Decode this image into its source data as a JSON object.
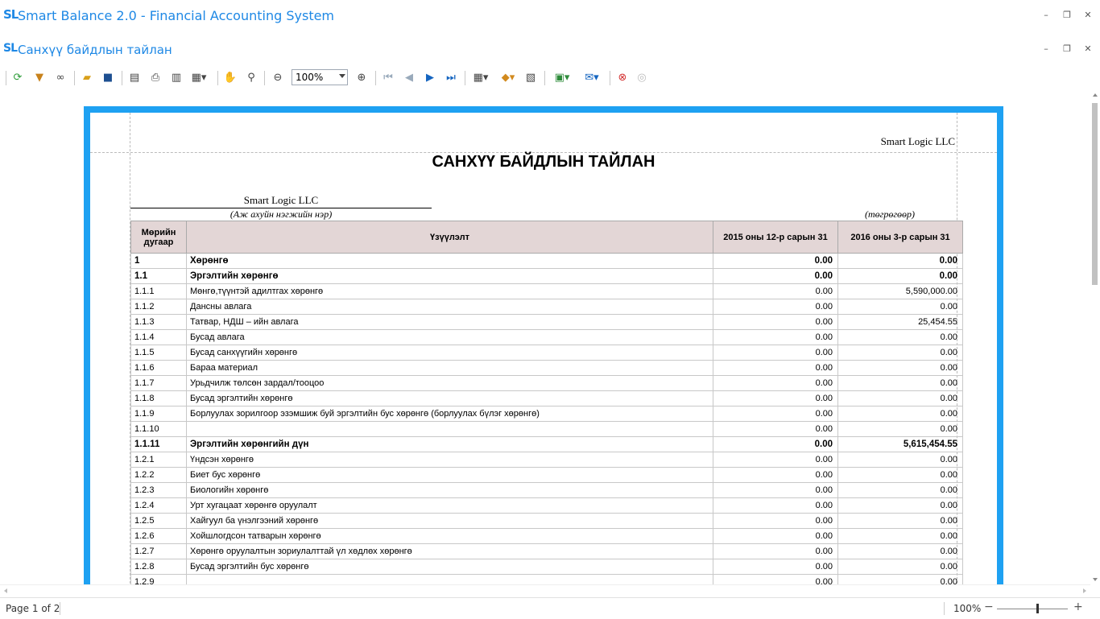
{
  "app": {
    "logo": "SL",
    "title": "Smart Balance 2.0 - Financial Accounting System",
    "window_title": "Санхүү байдлын тайлан"
  },
  "toolbar": {
    "zoom": "100%"
  },
  "report": {
    "company_top": "Smart Logic LLC",
    "title": "САНХҮҮ БАЙДЛЫН ТАЙЛАН",
    "company_name": "Smart Logic LLC",
    "company_caption": "(Аж ахуйн нэгжийн нэр)",
    "currency_caption": "(төгрөгөөр)",
    "columns": [
      "Мөрийн дугаар",
      "Үзүүлэлт",
      "2015 оны 12-р сарын 31",
      "2016 оны 3-р сарын 31"
    ],
    "rows": [
      {
        "code": "1",
        "name": "Хөрөнгө",
        "v1": "0.00",
        "v2": "0.00",
        "bold": true
      },
      {
        "code": "1.1",
        "name": "Эргэлтийн хөрөнгө",
        "v1": "0.00",
        "v2": "0.00",
        "bold": true
      },
      {
        "code": "1.1.1",
        "name": "Мөнгө,түүнтэй адилтгах хөрөнгө",
        "v1": "0.00",
        "v2": "5,590,000.00",
        "bold": false
      },
      {
        "code": "1.1.2",
        "name": "Дансны авлага",
        "v1": "0.00",
        "v2": "0.00",
        "bold": false
      },
      {
        "code": "1.1.3",
        "name": "Татвар, НДШ – ийн авлага",
        "v1": "0.00",
        "v2": "25,454.55",
        "bold": false
      },
      {
        "code": "1.1.4",
        "name": "Бусад авлага",
        "v1": "0.00",
        "v2": "0.00",
        "bold": false
      },
      {
        "code": "1.1.5",
        "name": "Бусад санхүүгийн хөрөнгө",
        "v1": "0.00",
        "v2": "0.00",
        "bold": false
      },
      {
        "code": "1.1.6",
        "name": "Бараа материал",
        "v1": "0.00",
        "v2": "0.00",
        "bold": false
      },
      {
        "code": "1.1.7",
        "name": "Урьдчилж төлсөн зардал/тооцоо",
        "v1": "0.00",
        "v2": "0.00",
        "bold": false
      },
      {
        "code": "1.1.8",
        "name": "Бусад эргэлтийн хөрөнгө",
        "v1": "0.00",
        "v2": "0.00",
        "bold": false
      },
      {
        "code": "1.1.9",
        "name": "Борлуулах зорилгоор эзэмшиж буй эргэлтийн бус хөрөнгө (борлуулах бүлэг хөрөнгө)",
        "v1": "0.00",
        "v2": "0.00",
        "bold": false
      },
      {
        "code": "1.1.10",
        "name": "",
        "v1": "0.00",
        "v2": "0.00",
        "bold": false
      },
      {
        "code": "1.1.11",
        "name": "Эргэлтийн хөрөнгийн дүн",
        "v1": "0.00",
        "v2": "5,615,454.55",
        "bold": true
      },
      {
        "code": "1.2.1",
        "name": "Үндсэн хөрөнгө",
        "v1": "0.00",
        "v2": "0.00",
        "bold": false
      },
      {
        "code": "1.2.2",
        "name": "Биет бус хөрөнгө",
        "v1": "0.00",
        "v2": "0.00",
        "bold": false
      },
      {
        "code": "1.2.3",
        "name": "Биологийн хөрөнгө",
        "v1": "0.00",
        "v2": "0.00",
        "bold": false
      },
      {
        "code": "1.2.4",
        "name": "Урт хугацаат хөрөнгө оруулалт",
        "v1": "0.00",
        "v2": "0.00",
        "bold": false
      },
      {
        "code": "1.2.5",
        "name": "Хайгуул ба үнэлгээний хөрөнгө",
        "v1": "0.00",
        "v2": "0.00",
        "bold": false
      },
      {
        "code": "1.2.6",
        "name": "Хойшлогдсон татварын хөрөнгө",
        "v1": "0.00",
        "v2": "0.00",
        "bold": false
      },
      {
        "code": "1.2.7",
        "name": "Хөрөнгө оруулалтын зориулалттай үл хөдлөх хөрөнгө",
        "v1": "0.00",
        "v2": "0.00",
        "bold": false
      },
      {
        "code": "1.2.8",
        "name": "Бусад эргэлтийн бус хөрөнгө",
        "v1": "0.00",
        "v2": "0.00",
        "bold": false
      },
      {
        "code": "1.2.9",
        "name": "",
        "v1": "0.00",
        "v2": "0.00",
        "bold": false
      }
    ]
  },
  "status": {
    "pages": "Page 1 of 2",
    "zoom": "100%"
  }
}
